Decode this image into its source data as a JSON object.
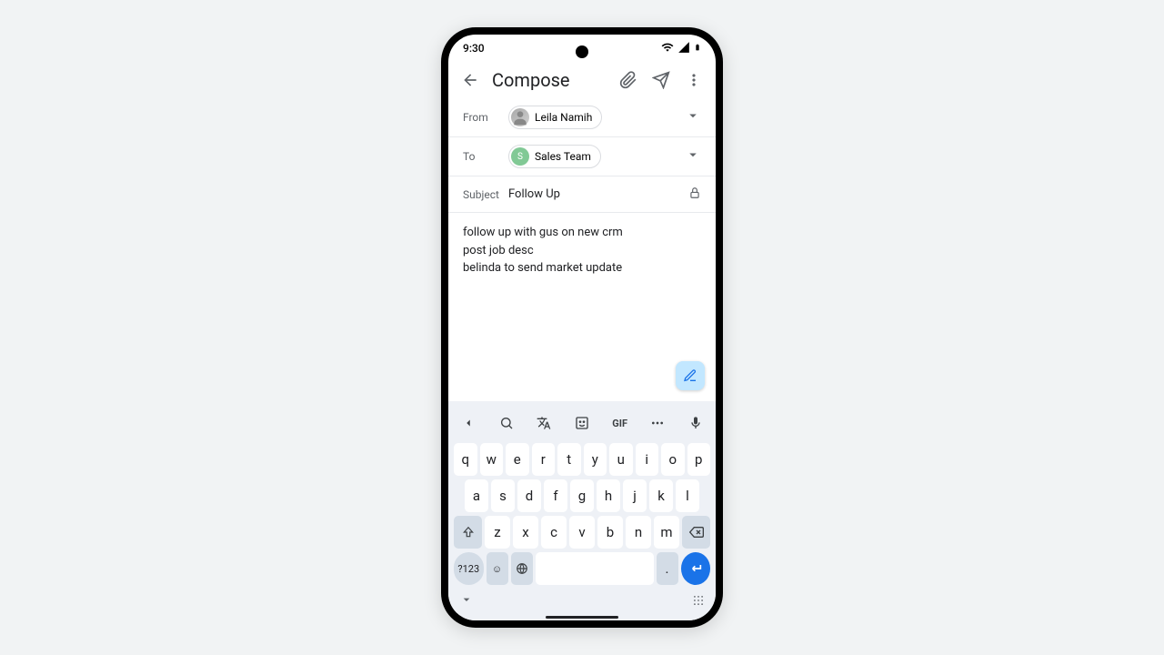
{
  "status": {
    "time": "9:30"
  },
  "appbar": {
    "title": "Compose"
  },
  "fields": {
    "from_label": "From",
    "from_name": "Leila Namih",
    "to_label": "To",
    "to_name": "Sales Team",
    "to_initial": "S",
    "subject_label": "Subject",
    "subject_value": "Follow Up"
  },
  "body": {
    "line1": "follow up with gus on new crm",
    "line2": "post job desc",
    "line3": "belinda to send market update"
  },
  "keyboard": {
    "gif": "GIF",
    "symbols": "?123",
    "comma": ",",
    "period": ".",
    "row1": {
      "k0": "q",
      "k1": "w",
      "k2": "e",
      "k3": "r",
      "k4": "t",
      "k5": "y",
      "k6": "u",
      "k7": "i",
      "k8": "o",
      "k9": "p"
    },
    "row2": {
      "k0": "a",
      "k1": "s",
      "k2": "d",
      "k3": "f",
      "k4": "g",
      "k5": "h",
      "k6": "j",
      "k7": "k",
      "k8": "l"
    },
    "row3": {
      "k0": "z",
      "k1": "x",
      "k2": "c",
      "k3": "v",
      "k4": "b",
      "k5": "n",
      "k6": "m"
    }
  }
}
